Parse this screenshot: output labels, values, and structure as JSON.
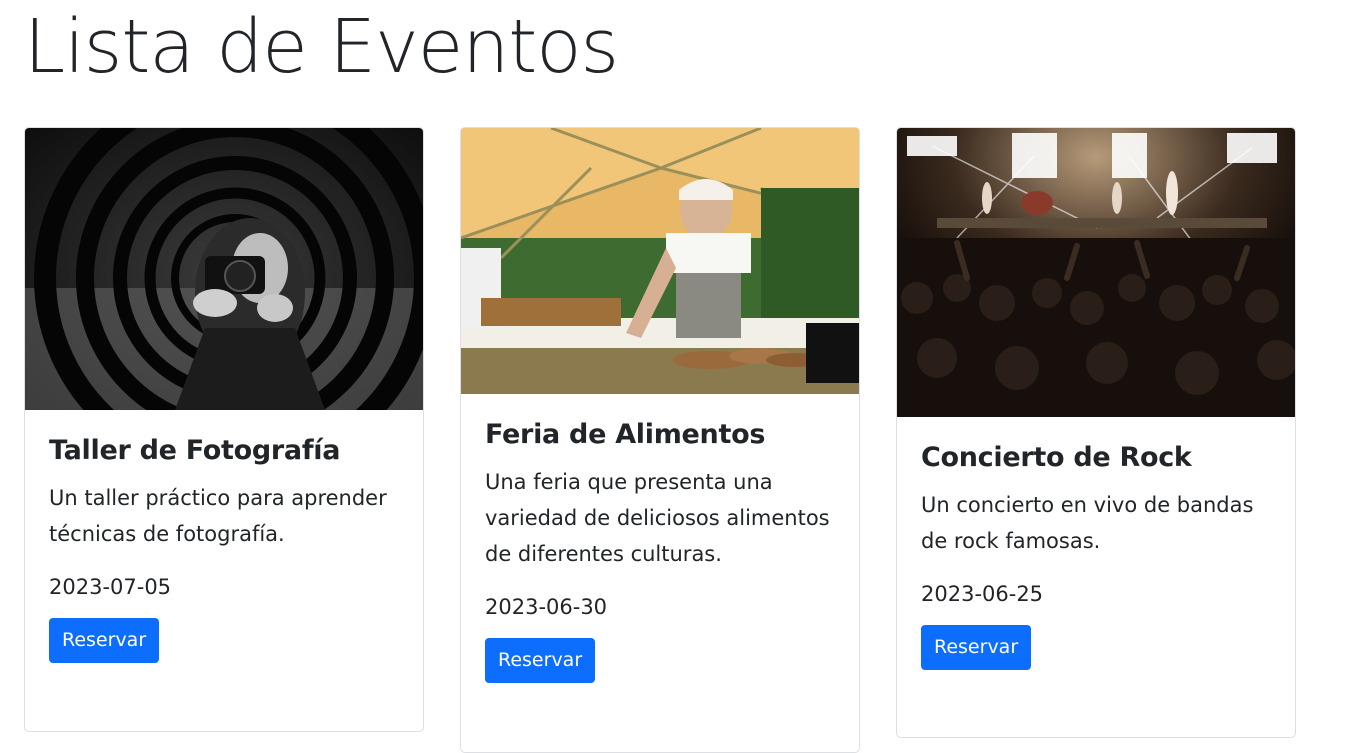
{
  "page": {
    "title": "Lista de Eventos"
  },
  "events": [
    {
      "title": "Taller de Fotografía",
      "description": "Un taller práctico para aprender técnicas de fotografía.",
      "date": "2023-07-05",
      "button_label": "Reservar",
      "image_subject": "photographer-behind-concentric-rings-bw"
    },
    {
      "title": "Feria de Alimentos",
      "description": "Una feria que presenta una variedad de deliciosos alimentos de diferentes culturas.",
      "date": "2023-06-30",
      "button_label": "Reservar",
      "image_subject": "food-market-stall-under-tent"
    },
    {
      "title": "Concierto de Rock",
      "description": "Un concierto en vivo de bandas de rock famosas.",
      "date": "2023-06-25",
      "button_label": "Reservar",
      "image_subject": "rock-concert-crowd-stage-lights"
    }
  ],
  "colors": {
    "primary": "#0d6efd",
    "text": "#212529",
    "border": "#dcdfe3"
  }
}
